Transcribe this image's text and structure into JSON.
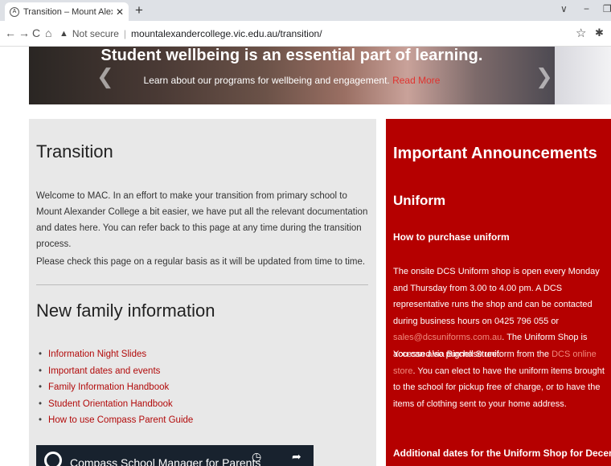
{
  "browser": {
    "tab_title": "Transition – Mount Alexander Co",
    "tab_close": "✕",
    "new_tab": "+",
    "not_secure": "Not secure",
    "url": "mountalexandercollege.vic.edu.au/transition/",
    "back": "←",
    "forward": "→",
    "reload": "C",
    "home": "⌂"
  },
  "hero": {
    "title": "Student wellbeing is an essential part of learning.",
    "subtitle": "Learn about our programs for wellbeing and engagement.",
    "link": "Read More"
  },
  "left": {
    "heading": "Transition",
    "intro": "Welcome to MAC. In an effort to make your transition from primary school to Mount Alexander College a bit easier, we have put all the relevant documentation and dates here. You can refer back to this page at any time during the transition process.",
    "note": "Please check this page on a regular basis as it will be updated from time to time.",
    "nfi_heading": "New family information",
    "links": [
      "Information Night Slides",
      "Important dates and events",
      "Family Information Handbook",
      "Student Orientation Handbook",
      "How to use Compass Parent Guide"
    ],
    "video_title": "Compass School Manager for Parents"
  },
  "right": {
    "heading": "Important Announcements",
    "uniform_heading": "Uniform",
    "how_heading": "How to purchase uniform",
    "p1_a": "The onsite DCS Uniform shop is open every Monday and Thursday from 3.00  to 4.00 pm. A DCS representative runs the shop and can be contacted during business hours on 0425 796 055 or ",
    "p1_email": "sales@dcsuniforms.com.au",
    "p1_b": ". The Uniform Shop is accessed via Bignell Street.",
    "p2_a": "You can also purchase uniform from the ",
    "p2_link": "DCS online store",
    "p2_b": ". You can elect to have the uniform items brought to the school for pickup free of charge, or to have the items of clothing sent to your home address.",
    "add_heading": "Additional dates for the Uniform Shop for December"
  }
}
